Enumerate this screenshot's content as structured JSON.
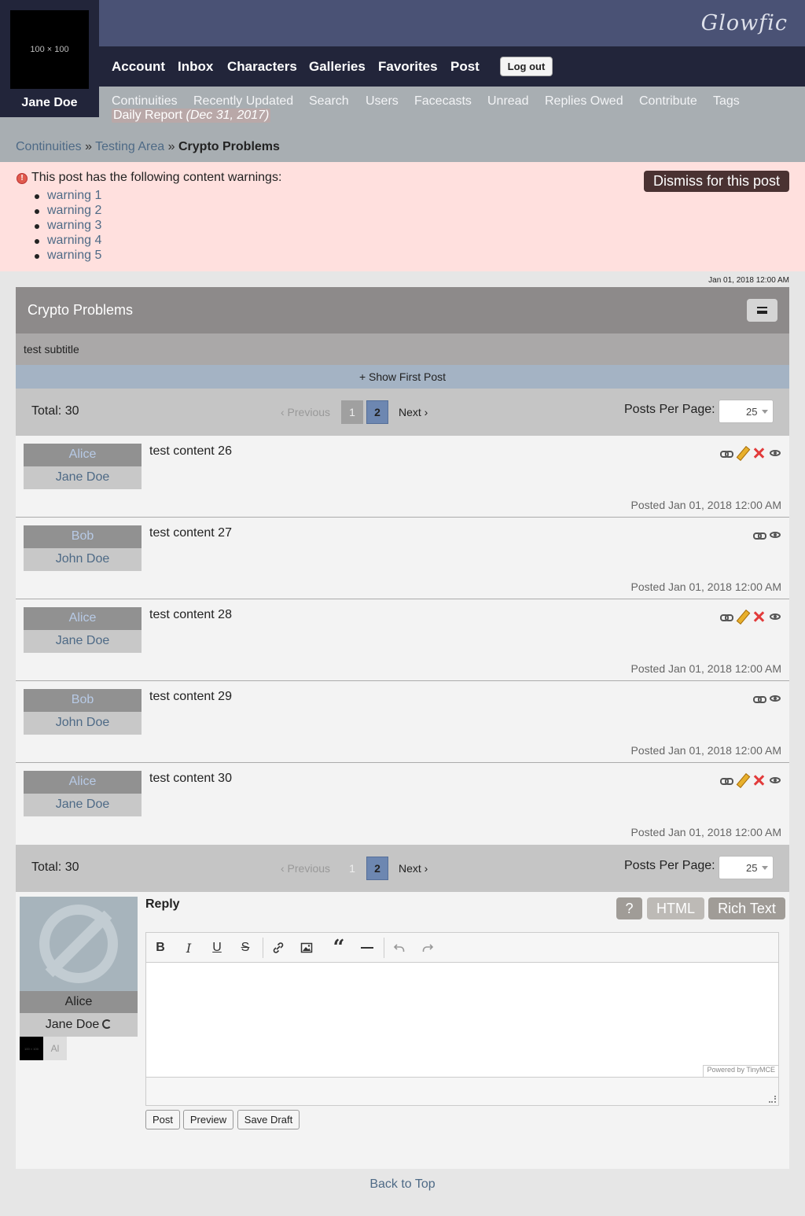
{
  "header": {
    "logo": "Glowfic",
    "user": {
      "avatar_text": "100 × 100",
      "name": "Jane Doe"
    },
    "nav": [
      "Account",
      "Inbox",
      "Characters",
      "Galleries",
      "Favorites",
      "Post"
    ],
    "logout": "Log out",
    "subnav": [
      "Continuities",
      "Recently Updated",
      "Search",
      "Users",
      "Facecasts",
      "Unread",
      "Replies Owed",
      "Contribute",
      "Tags"
    ],
    "daily_report": {
      "label": "Daily Report",
      "date": "(Dec 31, 2017)"
    }
  },
  "breadcrumb": {
    "first": "Continuities",
    "sep": "»",
    "second": "Testing Area",
    "current": "Crypto Problems"
  },
  "warnings": {
    "icon": "!",
    "title": "This post has the following content warnings:",
    "items": [
      "warning 1",
      "warning 2",
      "warning 3",
      "warning 4",
      "warning 5"
    ],
    "dismiss": "Dismiss for this post"
  },
  "post": {
    "timestamp": "Jan 01, 2018 12:00 AM",
    "title": "Crypto Problems",
    "subtitle": "test subtitle",
    "show_first": "+ Show First Post"
  },
  "pager": {
    "total": "Total: 30",
    "prev": "‹ Previous",
    "page1": "1",
    "page2": "2",
    "next": "Next ›",
    "ppp_label": "Posts Per Page:",
    "ppp_value": "25"
  },
  "replies": [
    {
      "character": "Alice",
      "author": "Jane Doe",
      "content": "test content 26",
      "posted": "Posted Jan 01, 2018 12:00 AM"
    },
    {
      "character": "Bob",
      "author": "John Doe",
      "content": "test content 27",
      "posted": "Posted Jan 01, 2018 12:00 AM"
    },
    {
      "character": "Alice",
      "author": "Jane Doe",
      "content": "test content 28",
      "posted": "Posted Jan 01, 2018 12:00 AM"
    },
    {
      "character": "Bob",
      "author": "John Doe",
      "content": "test content 29",
      "posted": "Posted Jan 01, 2018 12:00 AM"
    },
    {
      "character": "Alice",
      "author": "Jane Doe",
      "content": "test content 30",
      "posted": "Posted Jan 01, 2018 12:00 AM"
    }
  ],
  "reply_form": {
    "label": "Reply",
    "character": "Alice",
    "author": "Jane Doe",
    "mini_icon": "100 × 100",
    "mini_alias": "Al",
    "help": "?",
    "html": "HTML",
    "rich": "Rich Text",
    "powered": "Powered by TinyMCE",
    "post": "Post",
    "preview": "Preview",
    "save_draft": "Save Draft"
  },
  "back_to_top": "Back to Top"
}
